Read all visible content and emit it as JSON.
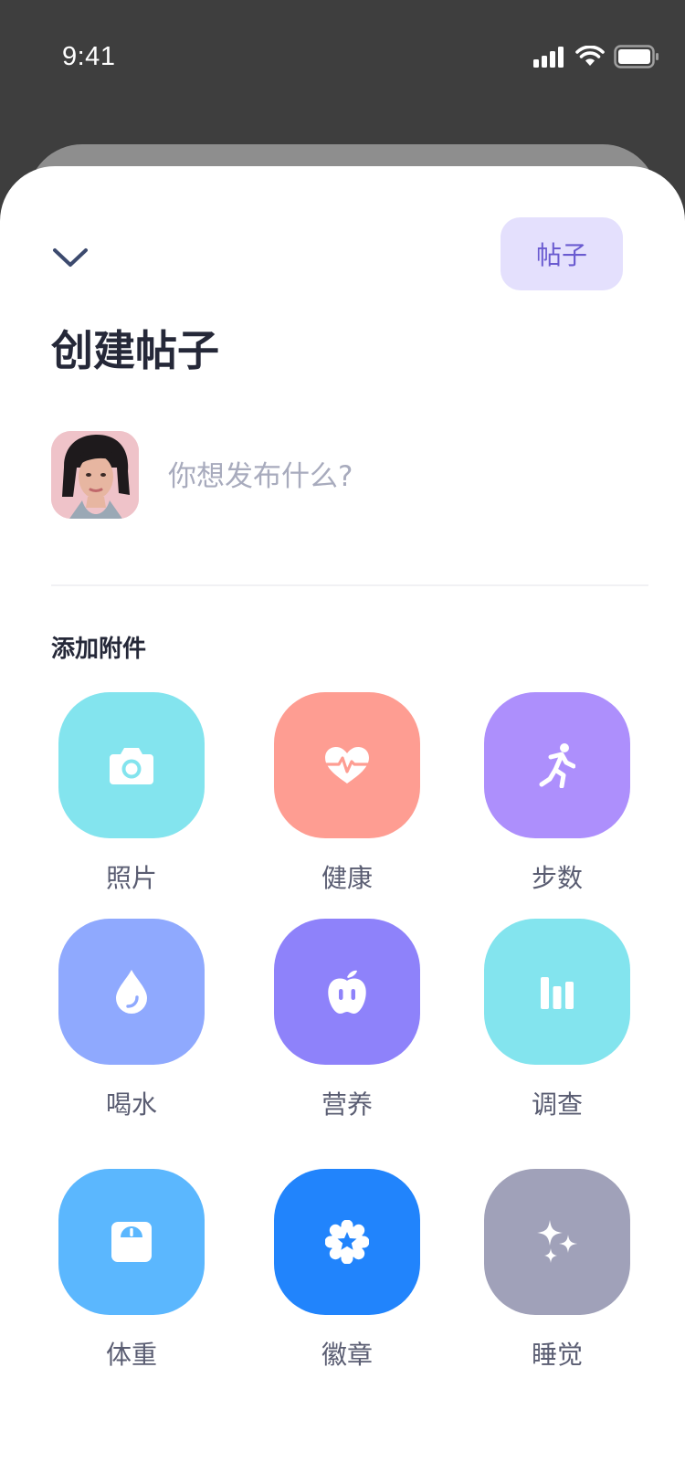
{
  "status_bar": {
    "time": "9:41",
    "icons": [
      "cellular-signal-icon",
      "wifi-icon",
      "battery-icon"
    ]
  },
  "header": {
    "collapse_icon": "chevron-down-icon",
    "post_button_label": "帖子",
    "title": "创建帖子"
  },
  "composer": {
    "avatar": "user-avatar",
    "placeholder": "你想发布什么?",
    "value": ""
  },
  "attachments": {
    "section_title": "添加附件",
    "items": [
      {
        "label": "照片",
        "icon": "camera-icon",
        "color": "#83e4ee"
      },
      {
        "label": "健康",
        "icon": "heart-pulse-icon",
        "color": "#fe9d92"
      },
      {
        "label": "步数",
        "icon": "running-person-icon",
        "color": "#ad8ffc"
      },
      {
        "label": "喝水",
        "icon": "water-drop-icon",
        "color": "#8fa9fe"
      },
      {
        "label": "营养",
        "icon": "apple-icon",
        "color": "#8e82fa"
      },
      {
        "label": "调查",
        "icon": "bar-chart-icon",
        "color": "#83e4ee"
      },
      {
        "label": "体重",
        "icon": "scale-icon",
        "color": "#5bb7fe"
      },
      {
        "label": "徽章",
        "icon": "badge-icon",
        "color": "#2184fc"
      },
      {
        "label": "睡觉",
        "icon": "sparkle-icon",
        "color": "#a0a1b9"
      }
    ]
  }
}
